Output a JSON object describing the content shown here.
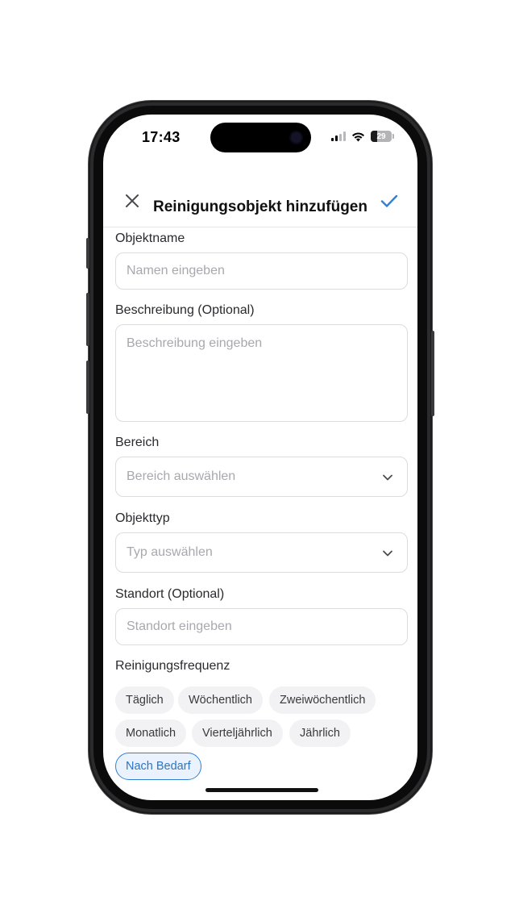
{
  "status_bar": {
    "time": "17:43",
    "battery_level": "29"
  },
  "header": {
    "title": "Reinigungsobjekt hinzufügen",
    "close_icon": "close-icon",
    "confirm_icon": "checkmark-icon"
  },
  "form": {
    "object_name": {
      "label": "Objektname",
      "placeholder": "Namen eingeben"
    },
    "description": {
      "label": "Beschreibung (Optional)",
      "placeholder": "Beschreibung eingeben"
    },
    "area": {
      "label": "Bereich",
      "placeholder": "Bereich auswählen"
    },
    "object_type": {
      "label": "Objekttyp",
      "placeholder": "Typ auswählen"
    },
    "location": {
      "label": "Standort (Optional)",
      "placeholder": "Standort eingeben"
    },
    "frequency": {
      "label": "Reinigungsfrequenz",
      "options": [
        "Täglich",
        "Wöchentlich",
        "Zweiwöchentlich",
        "Monatlich",
        "Vierteljährlich",
        "Jährlich",
        "Nach Bedarf"
      ],
      "selected": "Nach Bedarf"
    }
  },
  "colors": {
    "accent": "#2f80d6",
    "selected_chip_bg": "#eaf3fd",
    "chip_bg": "#f2f2f4",
    "border": "#dcdce0",
    "placeholder": "#a8a8ae"
  }
}
